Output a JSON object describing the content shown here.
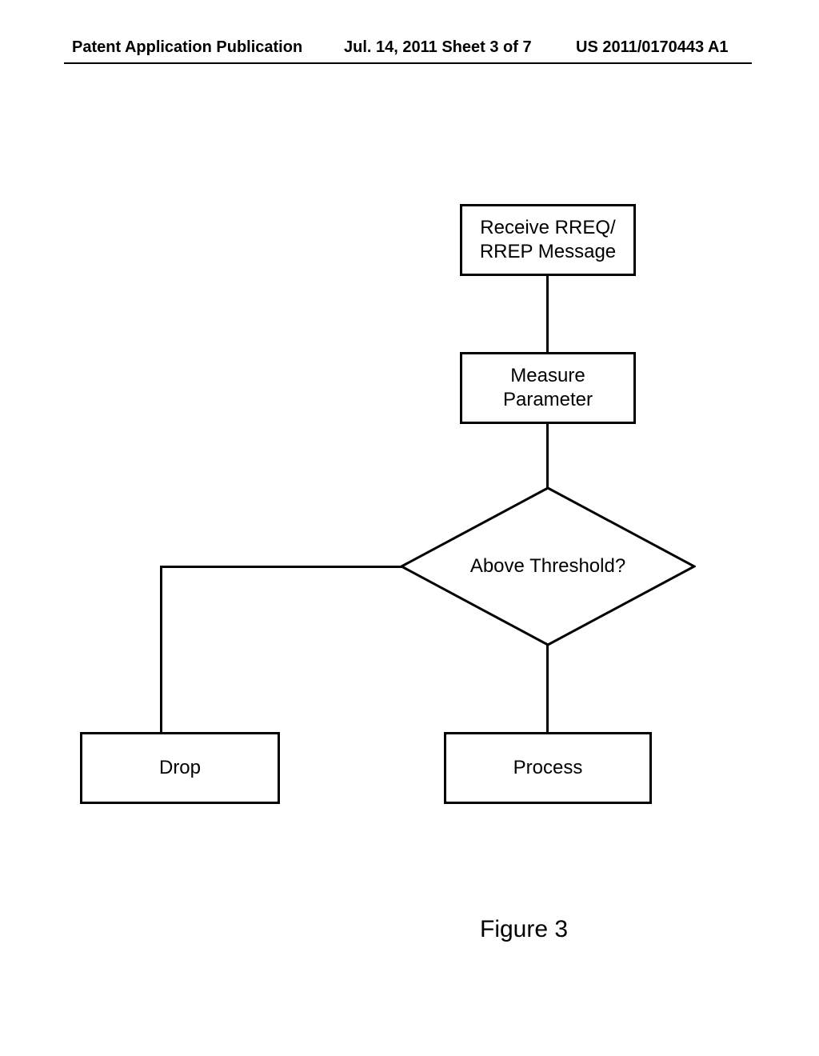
{
  "header": {
    "left": "Patent Application Publication",
    "mid": "Jul. 14, 2011 Sheet 3 of 7",
    "right": "US 2011/0170443 A1"
  },
  "flow": {
    "step1_line1": "Receive RREQ/",
    "step1_line2": "RREP Message",
    "step2_line1": "Measure",
    "step2_line2": "Parameter",
    "decision": "Above Threshold?",
    "drop": "Drop",
    "process": "Process"
  },
  "caption": "Figure 3"
}
